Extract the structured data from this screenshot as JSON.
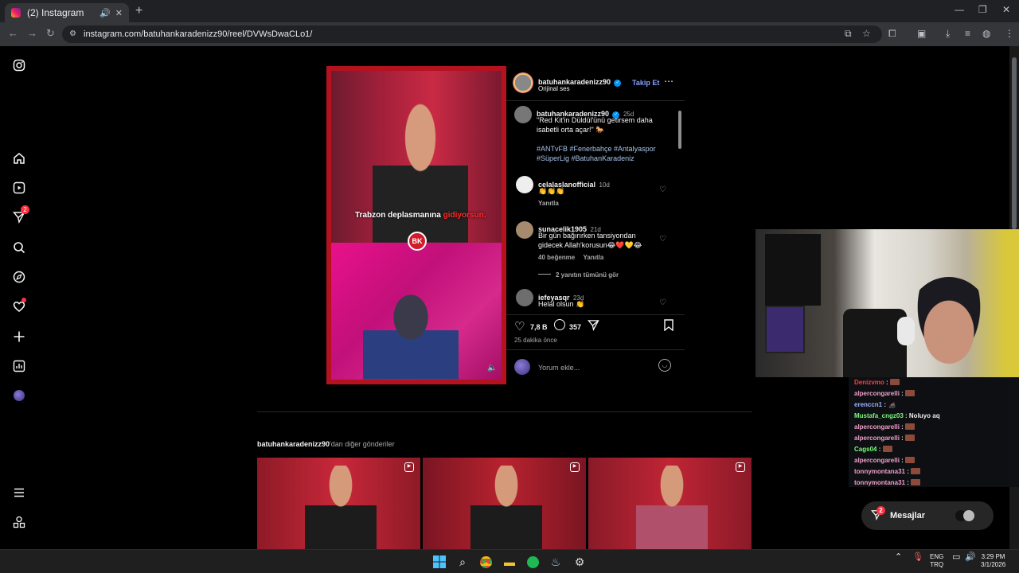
{
  "browser": {
    "tab_title": "(2) Instagram",
    "url": "instagram.com/batuhankaradenizz90/reel/DVWsDwaCLo1/"
  },
  "nav": {
    "notification_badge": "2"
  },
  "post": {
    "author": "batuhankaradenizz90",
    "audio": "Orijinal ses",
    "follow_label": "Takip Et",
    "subtitle_pre": "Trabzon deplasmanına ",
    "subtitle_hl": "gidiyorsun.",
    "logo_text": "BK",
    "caption": {
      "author": "batuhankaradenizz90",
      "age": "25d",
      "text_line1": "\"Red Kit'in Düldül'ünü getirsem daha",
      "text_line2": "isabetli orta açar!\" 🐎",
      "hashtags_line1": "#ANTvFB #Fenerbahçe #Antalyaspor",
      "hashtags_line2": "#SüperLig #BatuhanKaradeniz"
    },
    "comments": [
      {
        "user": "celalaslanofficial",
        "age": "10d",
        "text": "👏👏👏",
        "reply": "Yanıtla"
      },
      {
        "user": "sunacelik1905",
        "age": "21d",
        "text_line1": "Bir gün bağırırken tansiyondan",
        "text_line2": "gidecek Allah'korusun😂❤️💛😂",
        "likes": "40 beğenme",
        "reply": "Yanıtla"
      },
      {
        "user": "iefeyasqr",
        "age": "23d",
        "text": "Helal olsun 👏"
      }
    ],
    "view_replies": "2 yanıtın tümünü gör",
    "like_count": "7,8 B",
    "comment_count": "357",
    "time_ago": "25 dakika önce",
    "comment_placeholder": "Yorum ekle..."
  },
  "more": {
    "author": "batuhankaradenizz90",
    "suffix": "'dan diğer gönderiler"
  },
  "stream_chat": [
    {
      "user": "Denizvmo",
      "color": "#ff4040",
      "msg": "",
      "emote": true
    },
    {
      "user": "alpercongarelli",
      "color": "#f0a0c8",
      "msg": "",
      "emote": true
    },
    {
      "user": "erenccn1",
      "color": "#9fb4ff",
      "msg": "🦽",
      "emote": false
    },
    {
      "user": "Mustafa_cngz03",
      "color": "#7cfc7c",
      "msg": "Noluyo aq",
      "emote": false
    },
    {
      "user": "alpercongarelli",
      "color": "#f0a0c8",
      "msg": "",
      "emote": true
    },
    {
      "user": "alpercongarelli",
      "color": "#f0a0c8",
      "msg": "",
      "emote": true
    },
    {
      "user": "Cags04",
      "color": "#7cfc7c",
      "msg": "",
      "emote": true
    },
    {
      "user": "alpercongarelli",
      "color": "#f0a0c8",
      "msg": "",
      "emote": true
    },
    {
      "user": "tonnymontana31",
      "color": "#f0a0c8",
      "msg": "",
      "emote": true
    },
    {
      "user": "tonnymontana31",
      "color": "#f0a0c8",
      "msg": "",
      "emote": true
    }
  ],
  "messages": {
    "label": "Mesajlar",
    "badge": "2"
  },
  "taskbar": {
    "lang1": "ENG",
    "lang2": "TRQ",
    "time": "3:29 PM",
    "date": "3/1/2026"
  }
}
